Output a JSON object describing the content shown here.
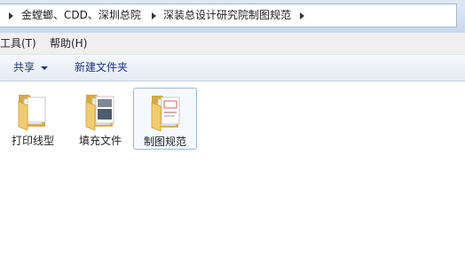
{
  "breadcrumb": {
    "items": [
      {
        "label": "金螳螂、CDD、深圳总院"
      },
      {
        "label": "深装总设计研究院制图规范"
      }
    ]
  },
  "menu": {
    "items": [
      {
        "label": "工具(T)"
      },
      {
        "label": "帮助(H)"
      }
    ]
  },
  "toolbar": {
    "share_label": "共享",
    "new_folder_label": "新建文件夹"
  },
  "folders": [
    {
      "name": "打印线型",
      "icon": "folder-icon",
      "selected": false
    },
    {
      "name": "填充文件",
      "icon": "folder-icon",
      "selected": false
    },
    {
      "name": "制图规范",
      "icon": "folder-icon",
      "selected": true
    }
  ],
  "colors": {
    "folder": "#f1cc6e",
    "toolbar_text": "#1e3287",
    "selection_border": "#9cb7d6"
  }
}
